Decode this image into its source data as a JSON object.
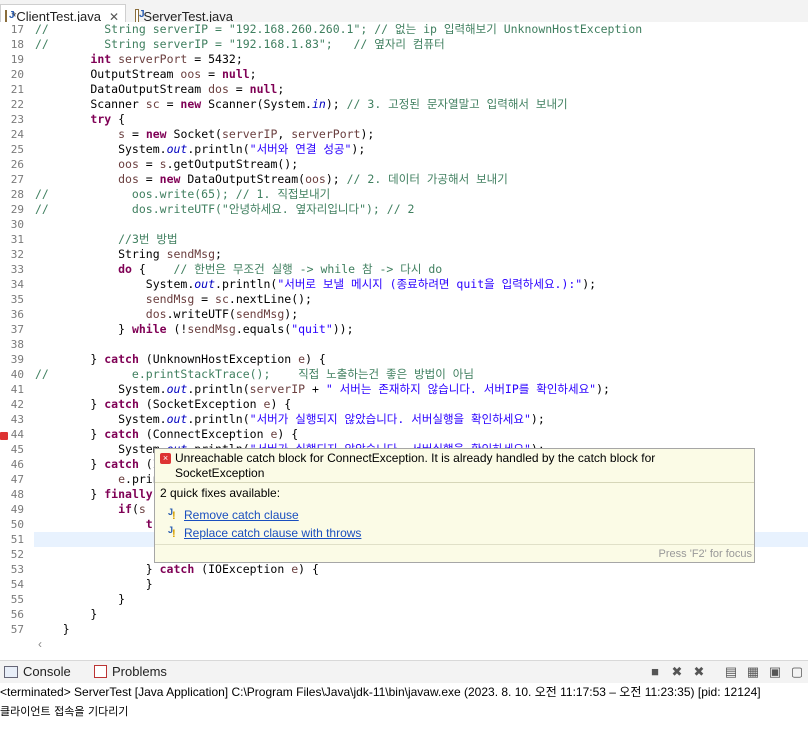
{
  "tabs": [
    {
      "label": "*ClientTest.java",
      "close": "✕",
      "active": true
    },
    {
      "label": "ServerTest.java",
      "active": false
    }
  ],
  "code_lines": [
    {
      "n": "17",
      "html": "<span class=\"cm\">//        String serverIP = \"192.168.260.260.1\"; // 없는 ip 입력해보기 UnknownHostException</span>"
    },
    {
      "n": "18",
      "html": "<span class=\"cm\">//        String serverIP = \"192.168.1.83\";   // 옆자리 컴퓨터</span>"
    },
    {
      "n": "19",
      "html": "        <span class=\"kw\">int</span> <span class=\"loc\">serverPort</span> = 5432;"
    },
    {
      "n": "20",
      "html": "        OutputStream <span class=\"loc\">oos</span> = <span class=\"kw\">null</span>;"
    },
    {
      "n": "21",
      "html": "        DataOutputStream <span class=\"loc\">dos</span> = <span class=\"kw\">null</span>;"
    },
    {
      "n": "22",
      "html": "        Scanner <span class=\"loc\">sc</span> = <span class=\"kw\">new</span> Scanner(System.<span class=\"fld\">in</span>); <span class=\"cm\">// 3. 고정된 문자열말고 입력해서 보내기</span>"
    },
    {
      "n": "23",
      "html": "        <span class=\"kw\">try</span> {"
    },
    {
      "n": "24",
      "html": "            <span class=\"loc\">s</span> = <span class=\"kw\">new</span> Socket(<span class=\"loc\">serverIP</span>, <span class=\"loc\">serverPort</span>);"
    },
    {
      "n": "25",
      "html": "            System.<span class=\"fld\">out</span>.println(<span class=\"str\">\"서버와 연결 성공\"</span>);"
    },
    {
      "n": "26",
      "html": "            <span class=\"loc\">oos</span> = <span class=\"loc\">s</span>.getOutputStream();"
    },
    {
      "n": "27",
      "html": "            <span class=\"loc\">dos</span> = <span class=\"kw\">new</span> DataOutputStream(<span class=\"loc\">oos</span>); <span class=\"cm\">// 2. 데이터 가공해서 보내기</span>"
    },
    {
      "n": "28",
      "html": "<span class=\"cm\">//            oos.write(65); // 1. 직접보내기</span>"
    },
    {
      "n": "29",
      "html": "<span class=\"cm\">//            dos.writeUTF(\"안녕하세요. 옆자리입니다\"); // 2</span>"
    },
    {
      "n": "30",
      "html": ""
    },
    {
      "n": "31",
      "html": "            <span class=\"cm\">//3번 방법</span>"
    },
    {
      "n": "32",
      "html": "            String <span class=\"loc\">sendMsg</span>;"
    },
    {
      "n": "33",
      "html": "            <span class=\"kw\">do</span> {    <span class=\"cm\">// 한번은 무조건 실행 -> while 참 -> 다시 do</span>"
    },
    {
      "n": "34",
      "html": "                System.<span class=\"fld\">out</span>.println(<span class=\"str\">\"서버로 보낼 메시지 (종료하려면 quit을 입력하세요.):\"</span>);"
    },
    {
      "n": "35",
      "html": "                <span class=\"loc\">sendMsg</span> = <span class=\"loc\">sc</span>.nextLine();"
    },
    {
      "n": "36",
      "html": "                <span class=\"loc\">dos</span>.writeUTF(<span class=\"loc\">sendMsg</span>);"
    },
    {
      "n": "37",
      "html": "            } <span class=\"kw\">while</span> (!<span class=\"loc\">sendMsg</span>.equals(<span class=\"str\">\"quit\"</span>));"
    },
    {
      "n": "38",
      "html": ""
    },
    {
      "n": "39",
      "html": "        } <span class=\"kw\">catch</span> (UnknownHostException <span class=\"loc\">e</span>) {"
    },
    {
      "n": "40",
      "html": "<span class=\"cm\">//            e.printStackTrace();    직접 노출하는건 좋은 방법이 아님</span>"
    },
    {
      "n": "41",
      "html": "            System.<span class=\"fld\">out</span>.println(<span class=\"loc\">serverIP</span> + <span class=\"str\">\" 서버는 존재하지 않습니다. 서버IP를 확인하세요\"</span>);"
    },
    {
      "n": "42",
      "html": "        } <span class=\"kw\">catch</span> (SocketException <span class=\"loc\">e</span>) {"
    },
    {
      "n": "43",
      "html": "            System.<span class=\"fld\">out</span>.println(<span class=\"str\">\"서버가 실행되지 않았습니다. 서버실행을 확인하세요\"</span>);"
    },
    {
      "n": "44",
      "html": "        } <span class=\"kw\">catch</span> (ConnectException <span class=\"loc\">e</span>) {"
    },
    {
      "n": "45",
      "html": "            System.<span class=\"fld\">out</span>.println(<span class=\"str\">\"서버가 실행되지 않았습니다. 서버실행을 확인하세요\"</span>);"
    },
    {
      "n": "46",
      "html": "        } <span class=\"kw\">catch</span> (IOException <span class=\"loc\">e</span>) {"
    },
    {
      "n": "47",
      "html": "            <span class=\"loc\">e</span>.printStackTrace();"
    },
    {
      "n": "48",
      "html": "        } <span class=\"kw\">finally</span> {"
    },
    {
      "n": "49",
      "html": "            <span class=\"kw\">if</span>(<span class=\"loc\">s</span> != <span class=\"kw\">null</span>) {"
    },
    {
      "n": "50",
      "html": "                <span class=\"kw\">try</span> {"
    },
    {
      "n": "51",
      "html": "                    <span class=\"loc\">s</span>.close();"
    },
    {
      "n": "52",
      "html": ""
    },
    {
      "n": "53",
      "html": "                } <span class=\"kw\">catch</span> (IOException <span class=\"loc\">e</span>) {"
    },
    {
      "n": "54",
      "html": "                }"
    },
    {
      "n": "55",
      "html": "            }"
    },
    {
      "n": "56",
      "html": "        }"
    },
    {
      "n": "57",
      "html": "    }"
    }
  ],
  "hover": {
    "message": "Unreachable catch block for ConnectException. It is already handled by the catch block for SocketException",
    "quick_fixes_title": "2 quick fixes available:",
    "fixes": [
      "Remove catch clause",
      "Replace catch clause with throws"
    ],
    "footer": "Press 'F2' for focus"
  },
  "console": {
    "tabs": [
      "Console",
      "Problems"
    ],
    "status": "<terminated> ServerTest [Java Application] C:\\Program Files\\Java\\jdk-11\\bin\\javaw.exe  (2023. 8. 10. 오전 11:17:53 – 오전 11:23:35) [pid: 12124]",
    "output": "클라이언트 접속을 기다리기"
  },
  "colors": {
    "keyword": "#7f0055",
    "string": "#2a00ff",
    "comment": "#3f7f5f",
    "field": "#0000c0",
    "link": "#1a4fbf"
  },
  "icons": [
    "java-file-icon",
    "close-icon",
    "error-icon",
    "quickfix-icon",
    "console-icon",
    "problems-icon",
    "terminate-icon",
    "remove-launch-icon",
    "remove-all-icon",
    "scroll-lock-icon",
    "word-wrap-icon",
    "pin-icon",
    "open-console-icon"
  ]
}
